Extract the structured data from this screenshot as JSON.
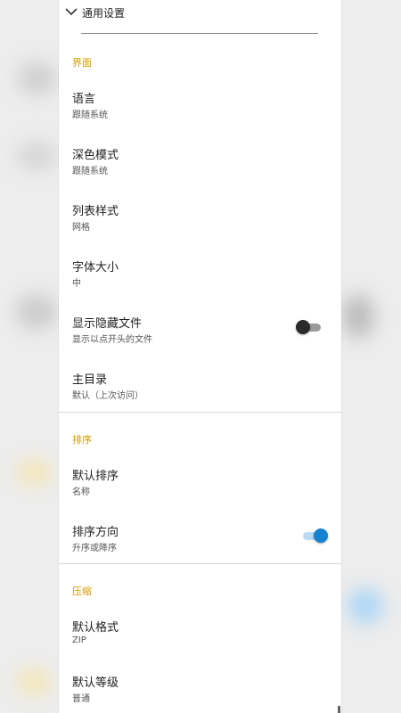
{
  "header": {
    "title": "通用设置"
  },
  "sections": [
    {
      "title": "界面",
      "items": [
        {
          "title": "语言",
          "subtitle": "跟随系统"
        },
        {
          "title": "深色模式",
          "subtitle": "跟随系统"
        },
        {
          "title": "列表样式",
          "subtitle": "网格"
        },
        {
          "title": "字体大小",
          "subtitle": "中"
        },
        {
          "title": "显示隐藏文件",
          "subtitle": "显示以点开头的文件",
          "toggle": false
        },
        {
          "title": "主目录",
          "subtitle": "默认（上次访问）"
        }
      ]
    },
    {
      "title": "排序",
      "items": [
        {
          "title": "默认排序",
          "subtitle": "名称"
        },
        {
          "title": "排序方向",
          "subtitle": "升序或降序",
          "toggle": true
        }
      ]
    },
    {
      "title": "压缩",
      "items": [
        {
          "title": "默认格式",
          "subtitle": "ZIP"
        },
        {
          "title": "默认等级",
          "subtitle": "普通"
        }
      ]
    }
  ],
  "colors": {
    "accent": "#d39a00",
    "toggle_on": "#1583d1",
    "toggle_off": "#2a2a2a"
  },
  "icons": {
    "collapse": "chevron-down-icon"
  }
}
